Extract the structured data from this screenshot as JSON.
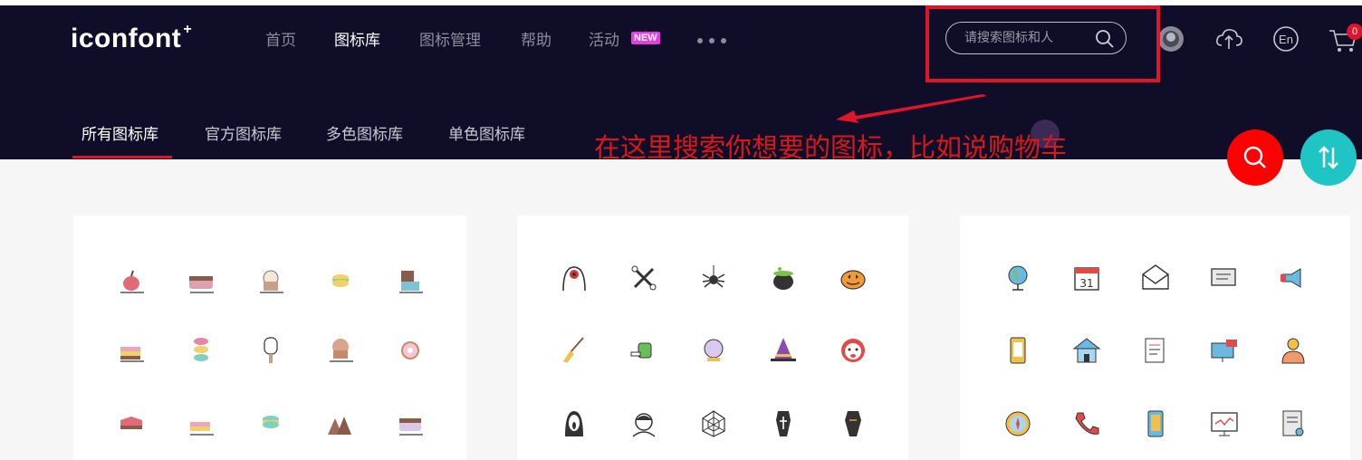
{
  "header": {
    "logo": "iconfont",
    "logo_plus": "+",
    "nav": [
      {
        "label": "首页"
      },
      {
        "label": "图标库",
        "active": true
      },
      {
        "label": "图标管理"
      },
      {
        "label": "帮助"
      },
      {
        "label": "活动",
        "badge": "NEW"
      }
    ],
    "more_icon": "more-dots-icon",
    "search": {
      "placeholder": "请搜索图标和人"
    },
    "cart_count": "0",
    "right_icons": [
      "avatar-icon",
      "upload-cloud-icon",
      "language-en-icon",
      "cart-icon"
    ]
  },
  "subnav": {
    "tabs": [
      {
        "label": "所有图标库",
        "active": true
      },
      {
        "label": "官方图标库"
      },
      {
        "label": "多色图标库"
      },
      {
        "label": "单色图标库"
      }
    ]
  },
  "annotation": {
    "text": "在这里搜索你想要的图标，比如说购物车"
  },
  "fabs": [
    {
      "name": "search-fab",
      "icon": "search-icon"
    },
    {
      "name": "sort-fab",
      "icon": "sort-arrows-icon"
    }
  ],
  "colors": {
    "header_bg": "#0f0d28",
    "accent_red": "#e0152b",
    "teal": "#1fc4c4"
  },
  "cards": [
    {
      "icons": [
        "fruit-icon",
        "cake-slice-icon",
        "cupcake-icon",
        "macaron-icon",
        "chocolate-bar-icon",
        "layer-cake-icon",
        "stacked-macaron-icon",
        "popsicle-icon",
        "muffin-icon",
        "donut-icon",
        "cake-piece-icon",
        "pastry-icon",
        "macaron-green-icon",
        "chocolate-pieces-icon",
        "frosted-cake-icon"
      ]
    },
    {
      "icons": [
        "eyeball-ghost-icon",
        "crossbones-icon",
        "spider-icon",
        "cauldron-icon",
        "pumpkin-icon",
        "broom-icon",
        "zombie-hand-icon",
        "crystal-ball-icon",
        "witch-hat-icon",
        "clown-icon",
        "scream-mask-icon",
        "vampire-icon",
        "spider-web-icon",
        "coffin-cross-icon",
        "coffin-icon"
      ]
    },
    {
      "icons": [
        "globe-icon",
        "calendar-icon",
        "mail-icon",
        "chat-card-icon",
        "megaphone-icon",
        "phone-app-icon",
        "home-icon",
        "checklist-icon",
        "monitor-mail-icon",
        "user-icon",
        "compass-icon",
        "phone-call-icon",
        "mobile-icon",
        "computer-icon",
        "document-icon"
      ]
    }
  ]
}
